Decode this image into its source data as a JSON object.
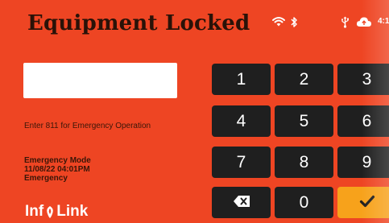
{
  "header": {
    "title": "Equipment Locked",
    "time": "4:1",
    "icons": [
      "wifi-icon",
      "bluetooth-icon",
      "usb-icon",
      "cloud-upload-icon"
    ]
  },
  "code_entry": {
    "value": "",
    "placeholder": ""
  },
  "hint": "Enter 811 for Emergency Operation",
  "emergency": {
    "mode": "Emergency Mode",
    "datetime": "11/08/22 04:01PM",
    "status": "Emergency"
  },
  "logo": {
    "left": "Inf",
    "right": "Link"
  },
  "keypad": {
    "k1": "1",
    "k2": "2",
    "k3": "3",
    "k4": "4",
    "k5": "5",
    "k6": "6",
    "k7": "7",
    "k8": "8",
    "k9": "9",
    "k0": "0",
    "backspace_icon": "backspace-icon",
    "enter_icon": "checkmark-icon"
  },
  "colors": {
    "background": "#ee4523",
    "key": "#1f1f1f",
    "enter_key": "#f7a21b",
    "title_text": "#2a1208",
    "label_text": "#3a1608"
  }
}
